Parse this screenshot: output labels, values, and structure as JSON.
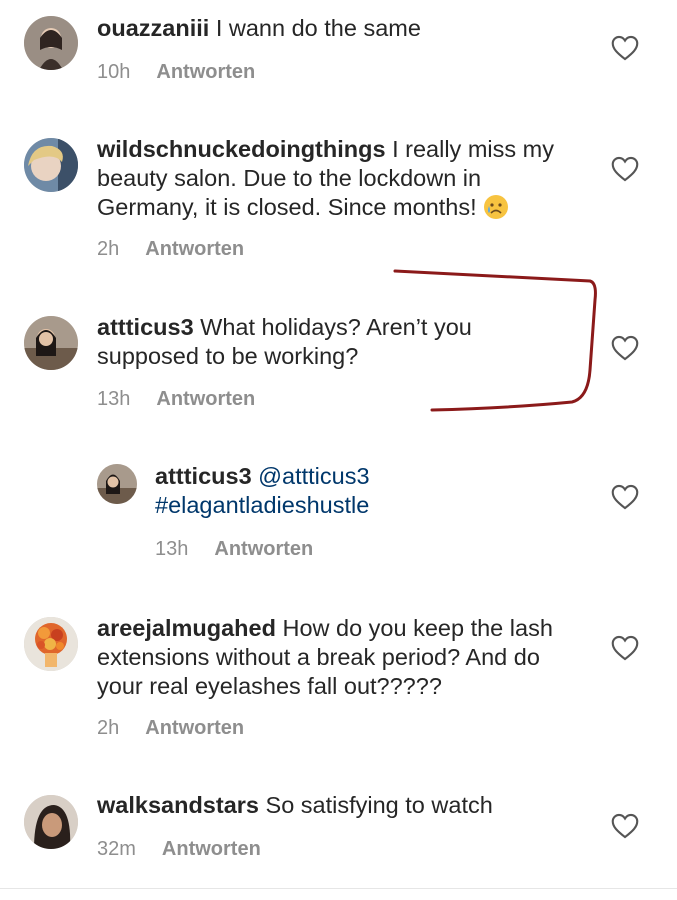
{
  "comments": [
    {
      "username": "ouazzaniii",
      "text": " I wann do the same",
      "time": "10h",
      "reply": "Antworten"
    },
    {
      "username": "wildschnuckedoingthings",
      "text": " I really miss my beauty salon. Due to the lockdown in Germany, it is closed. Since months! ",
      "time": "2h",
      "reply": "Antworten"
    },
    {
      "username": "attticus3",
      "text": " What holidays? Aren’t you supposed to be working?",
      "time": "13h",
      "reply": "Antworten"
    },
    {
      "username": "attticus3",
      "mention": " @attticus3",
      "hashtag": "#elagantladieshustle",
      "time": "13h",
      "reply": "Antworten"
    },
    {
      "username": "areejalmugahed",
      "text": " How do you keep the lash extensions without a break period? And do your real eyelashes fall out?????",
      "time": "2h",
      "reply": "Antworten"
    },
    {
      "username": "walksandstars",
      "text": " So satisfying to watch",
      "time": "32m",
      "reply": "Antworten"
    }
  ],
  "icons": {
    "like": "heart-outline-icon",
    "emoji": "sad-face-emoji"
  },
  "colors": {
    "text": "#262626",
    "meta": "#8e8e8e",
    "link": "#00376b",
    "annotation": "#8b1a1a"
  }
}
